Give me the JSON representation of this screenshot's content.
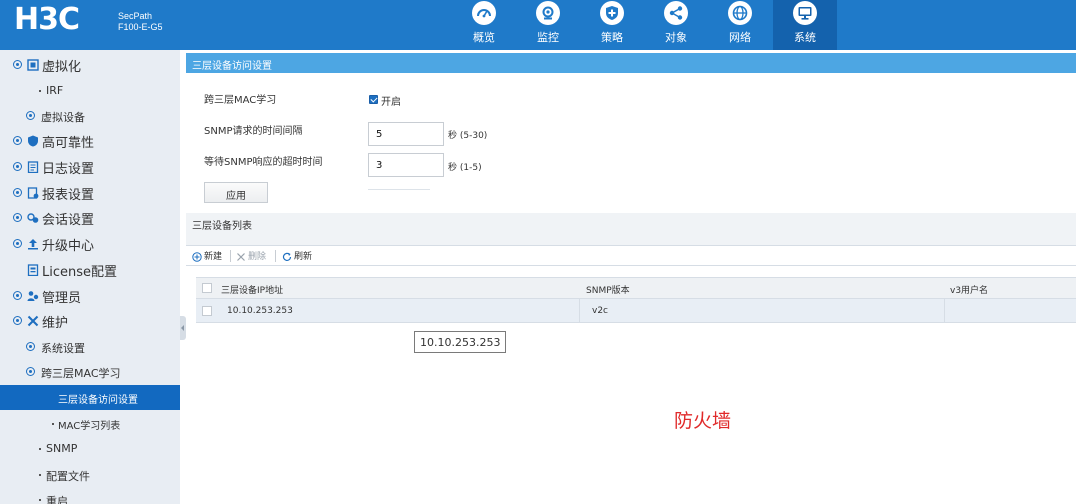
{
  "header": {
    "logo": "H3C",
    "product_line1": "SecPath",
    "product_line2": "F100-E-G5",
    "nav": [
      {
        "label": "概览",
        "icon": "gauge-icon"
      },
      {
        "label": "监控",
        "icon": "camera-icon"
      },
      {
        "label": "策略",
        "icon": "shield-plus-icon"
      },
      {
        "label": "对象",
        "icon": "share-nodes-icon"
      },
      {
        "label": "网络",
        "icon": "globe-icon"
      },
      {
        "label": "系统",
        "icon": "monitor-icon",
        "active": true
      }
    ]
  },
  "sidebar": {
    "items": [
      {
        "label": "虚拟化"
      },
      {
        "label": "IRF"
      },
      {
        "label": "虚拟设备"
      },
      {
        "label": "高可靠性"
      },
      {
        "label": "日志设置"
      },
      {
        "label": "报表设置"
      },
      {
        "label": "会话设置"
      },
      {
        "label": "升级中心"
      },
      {
        "label": "License配置"
      },
      {
        "label": "管理员"
      },
      {
        "label": "维护"
      },
      {
        "label": "系统设置"
      },
      {
        "label": "跨三层MAC学习"
      },
      {
        "label": "三层设备访问设置",
        "selected": true
      },
      {
        "label": "MAC学习列表"
      },
      {
        "label": "SNMP"
      },
      {
        "label": "配置文件"
      },
      {
        "label": "重启"
      }
    ]
  },
  "main": {
    "section_title": "三层设备访问设置",
    "form": {
      "mac_learning_label": "跨三层MAC学习",
      "mac_learning_checked": true,
      "mac_learning_option": "开启",
      "snmp_interval_label": "SNMP请求的时间间隔",
      "snmp_interval_value": "5",
      "snmp_interval_unit": "秒 (5-30)",
      "snmp_timeout_label": "等待SNMP响应的超时时间",
      "snmp_timeout_value": "3",
      "snmp_timeout_unit": "秒 (1-5)",
      "apply_label": "应用"
    },
    "list_title": "三层设备列表",
    "toolbar": {
      "new_label": "新建",
      "delete_label": "删除",
      "refresh_label": "刷新"
    },
    "table": {
      "columns": [
        "三层设备IP地址",
        "SNMP版本",
        "v3用户名"
      ],
      "rows": [
        {
          "ip": "10.10.253.253",
          "snmp_version": "v2c",
          "v3_user": ""
        }
      ]
    },
    "tooltip": "10.10.253.253",
    "watermark": "防火墙"
  },
  "colors": {
    "header_bg": "#1f7ac9",
    "nav_active_bg": "#1462ad",
    "sidebar_bg": "#e8edf3",
    "sidebar_selected_bg": "#1269c0",
    "section_head_bg": "#4da6e3",
    "watermark": "#e02a2a"
  }
}
